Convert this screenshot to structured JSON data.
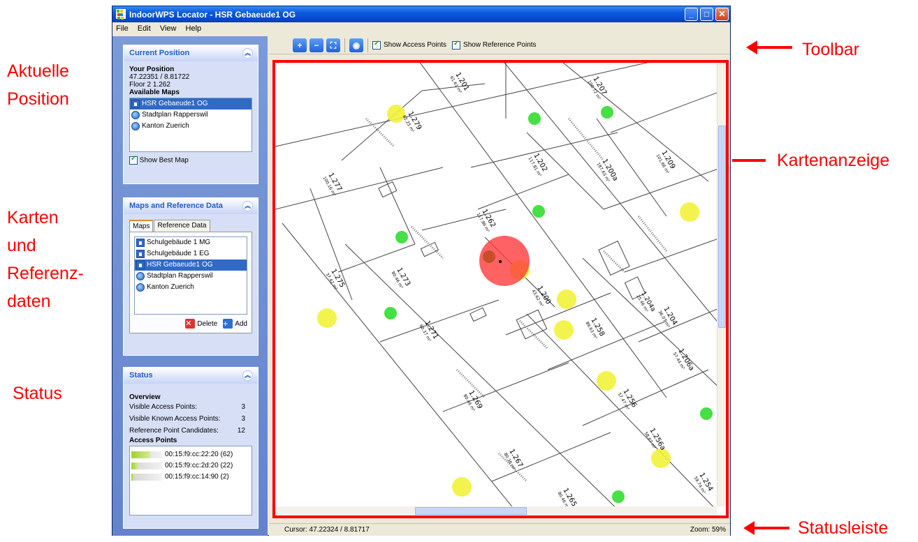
{
  "window": {
    "title": "IndoorWPS Locator - HSR Gebaeude1 OG",
    "menu": [
      "File",
      "Edit",
      "View",
      "Help"
    ],
    "minimize": "_",
    "maximize": "□",
    "close": "✕"
  },
  "current_position": {
    "header": "Current Position",
    "your_position_label": "Your Position",
    "coords": "47.22351 / 8.81722",
    "floor": "Floor 2 1.262",
    "available_maps_label": "Available Maps",
    "maps": [
      {
        "label": "HSR Gebaeude1 OG",
        "icon": "house-icon",
        "selected": true
      },
      {
        "label": "Stadtplan Rapperswil",
        "icon": "globe-icon",
        "selected": false
      },
      {
        "label": "Kanton Zuerich",
        "icon": "globe-icon",
        "selected": false
      }
    ],
    "show_best_map": "Show Best Map"
  },
  "maps_ref": {
    "header": "Maps and Reference Data",
    "tabs": [
      "Maps",
      "Reference Data"
    ],
    "maps": [
      {
        "label": "Schulgebäude 1 MG",
        "icon": "house-icon",
        "selected": false
      },
      {
        "label": "Schulgebäude 1 EG",
        "icon": "house-icon",
        "selected": false
      },
      {
        "label": "HSR Gebaeude1 OG",
        "icon": "house-icon",
        "selected": true
      },
      {
        "label": "Stadtplan Rapperswil",
        "icon": "globe-icon",
        "selected": false
      },
      {
        "label": "Kanton Zuerich",
        "icon": "globe-icon",
        "selected": false
      }
    ],
    "delete": "Delete",
    "add": "Add"
  },
  "status": {
    "header": "Status",
    "overview": "Overview",
    "rows": [
      {
        "label": "Visible Access Points:",
        "value": "3"
      },
      {
        "label": "Visible Known Access Points:",
        "value": "3"
      },
      {
        "label": "Reference Point Candidates:",
        "value": "12"
      }
    ],
    "access_points_label": "Access Points",
    "access_points": [
      {
        "mac": "00:15:f9:cc:22:20 (62)",
        "strength": 0.62
      },
      {
        "mac": "00:15:f9:cc:2d:20 (22)",
        "strength": 0.22
      },
      {
        "mac": "00:15:f9:cc:14:90 (2)",
        "strength": 0.1
      }
    ]
  },
  "toolbar": {
    "show_access_points": "Show Access Points",
    "show_reference_points": "Show Reference Points"
  },
  "map": {
    "rooms": [
      {
        "number": "1.201",
        "area": "61.61 m²"
      },
      {
        "number": "1.207",
        "area": "100.72 m²"
      },
      {
        "number": "1.279",
        "area": "62.25 m²"
      },
      {
        "number": "1.209",
        "area": "101.66 m²"
      },
      {
        "number": "1.202",
        "area": "117.81 m²"
      },
      {
        "number": "1.200a",
        "area": "187.63 m²"
      },
      {
        "number": "1.277",
        "area": "100.16 m²"
      },
      {
        "number": "1.262",
        "area": "117.86 m²"
      },
      {
        "number": "1.275",
        "area": "37.42 m²"
      },
      {
        "number": "1.273",
        "area": "80.46 m²"
      },
      {
        "number": "1.200",
        "area": "43.62 m²"
      },
      {
        "number": "1.204a",
        "area": "25.46 m²"
      },
      {
        "number": "1.204",
        "area": "36.07 m²"
      },
      {
        "number": "1.258",
        "area": "89.63 m²"
      },
      {
        "number": "1.271",
        "area": "60.37 m²"
      },
      {
        "number": "1.206a",
        "area": "57.44 m²"
      },
      {
        "number": "1.256",
        "area": "57.47 m²"
      },
      {
        "number": "1.269",
        "area": "80.46 m²"
      },
      {
        "number": "1.256a",
        "area": "58.67 m²"
      },
      {
        "number": "1.267",
        "area": "80.36 m²"
      },
      {
        "number": "1.254",
        "area": "59.74 m²"
      },
      {
        "number": "1.265",
        "area": "80.46 m²"
      }
    ]
  },
  "statusbar": {
    "cursor": "Cursor: 47.22324 / 8.81717",
    "zoom": "Zoom: 59%"
  },
  "annotations": {
    "aktuelle": [
      "Aktuelle",
      "Position"
    ],
    "karten": [
      "Karten",
      "und",
      "Referenz-",
      "daten"
    ],
    "status": "Status",
    "toolbar": "Toolbar",
    "kartenanzeige": "Kartenanzeige",
    "statusleiste": "Statusleiste",
    "color": "#ff0000"
  }
}
